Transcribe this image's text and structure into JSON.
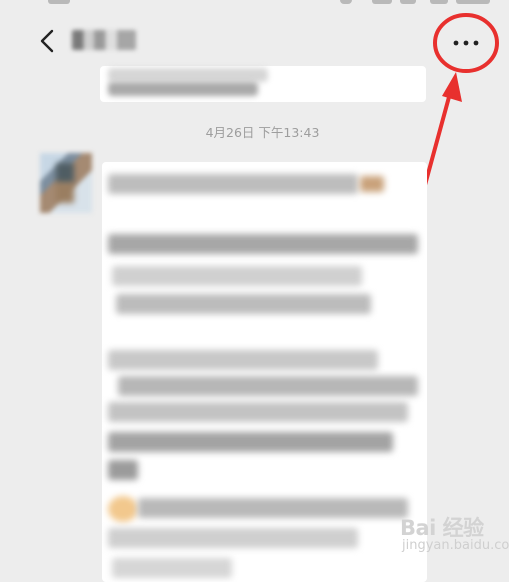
{
  "header": {
    "more_label": "..."
  },
  "chat": {
    "timestamp": "4月26日 下午13:43"
  },
  "watermark": {
    "main": "Bai 经验",
    "sub": "jingyan.baidu.com"
  },
  "colors": {
    "background": "#ededed",
    "bubble": "#ffffff",
    "highlight": "#e8302e",
    "timestamp": "#9d9d9d"
  },
  "icons": [
    "back-chevron-icon",
    "more-dots-icon"
  ]
}
